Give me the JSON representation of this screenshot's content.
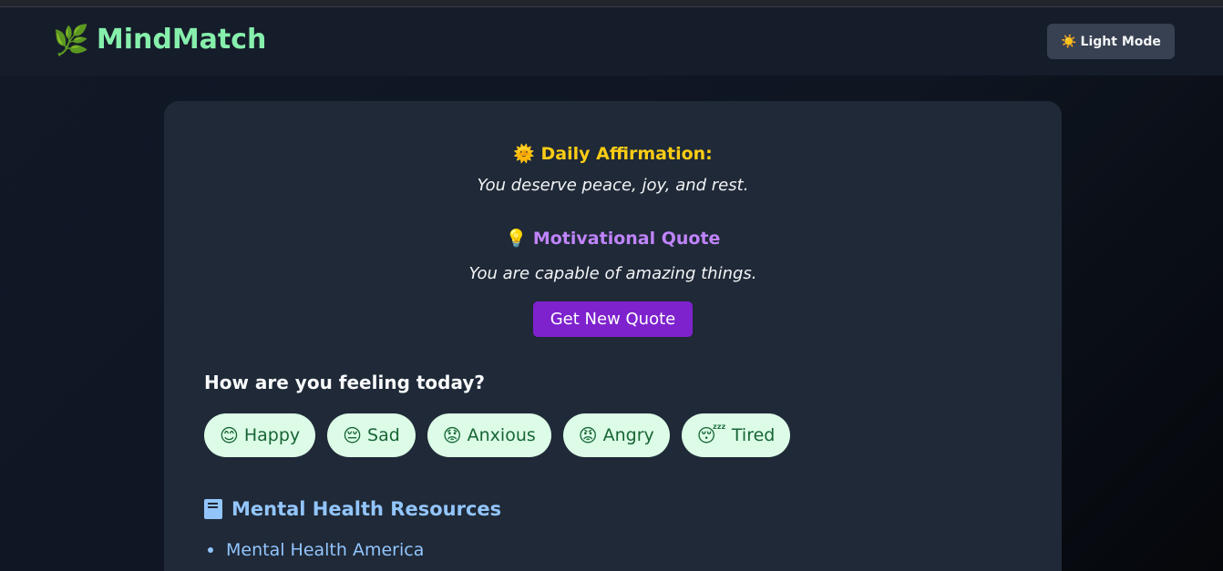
{
  "app": {
    "brand_icon": "🌿",
    "brand_name": "MindMatch",
    "theme_toggle_icon": "☀️",
    "theme_toggle_label": "Light Mode"
  },
  "affirmation": {
    "icon": "🌞",
    "title": "Daily Affirmation:",
    "text": "You deserve peace, joy, and rest."
  },
  "quote": {
    "icon": "💡",
    "title": "Motivational Quote",
    "text": "You are capable of amazing things.",
    "button_label": "Get New Quote"
  },
  "mood": {
    "question": "How are you feeling today?",
    "options": [
      {
        "emoji": "😊",
        "label": "Happy"
      },
      {
        "emoji": "😔",
        "label": "Sad"
      },
      {
        "emoji": "😟",
        "label": "Anxious"
      },
      {
        "emoji": "😡",
        "label": "Angry"
      },
      {
        "emoji": "😴",
        "label": "Tired"
      }
    ]
  },
  "resources": {
    "icon": "book-icon",
    "title": "Mental Health Resources",
    "links": [
      {
        "label": "Mental Health America"
      }
    ]
  },
  "colors": {
    "brand": "#86efac",
    "affirmation_title": "#facc15",
    "quote_title": "#c084fc",
    "quote_button": "#7e22ce",
    "mood_pill_bg": "#dcfce7",
    "resources": "#93c5fd"
  }
}
